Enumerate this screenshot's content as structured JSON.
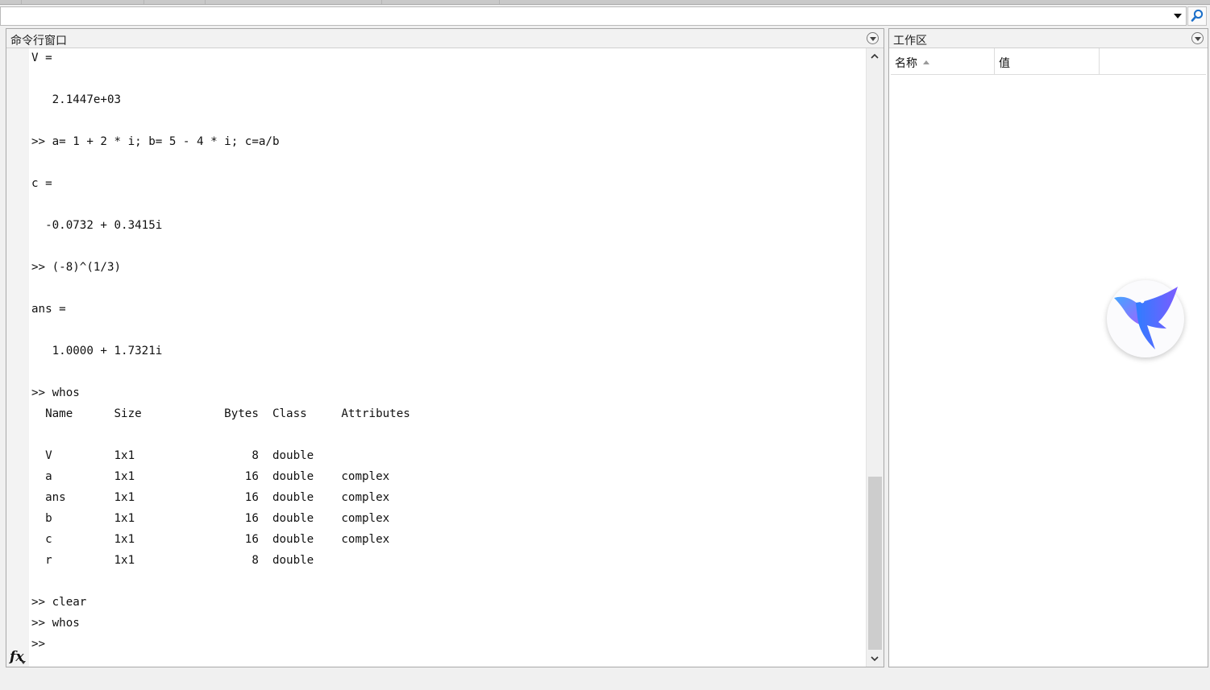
{
  "command_window": {
    "title": "命令行窗口",
    "output": "V =\n\n   2.1447e+03\n\n>> a= 1 + 2 * i; b= 5 - 4 * i; c=a/b\n\nc =\n\n  -0.0732 + 0.3415i\n\n>> (-8)^(1/3)\n\nans =\n\n   1.0000 + 1.7321i\n\n>> whos\n  Name      Size            Bytes  Class     Attributes\n\n  V         1x1                 8  double              \n  a         1x1                16  double    complex   \n  ans       1x1                16  double    complex   \n  b         1x1                16  double    complex   \n  c         1x1                16  double    complex   \n  r         1x1                 8  double              \n\n>> clear\n>> whos\n>> ",
    "prompt_icon": "fx-icon"
  },
  "workspace": {
    "title": "工作区",
    "columns": [
      "名称",
      "值",
      ""
    ],
    "sort_column": "名称",
    "sort_direction": "ascending"
  },
  "address_bar": {
    "value": "",
    "dropdown_icon": "chevron-down-icon",
    "search_icon": "search-icon"
  },
  "overlay": {
    "icon": "hummingbird-logo-icon"
  },
  "colors": {
    "panel_border": "#a9a9a9",
    "header_bg": "#f2f2f2",
    "search_blue": "#1b6fc9",
    "bird_gradient_start": "#3ba0ff",
    "bird_gradient_end": "#a355ff"
  }
}
